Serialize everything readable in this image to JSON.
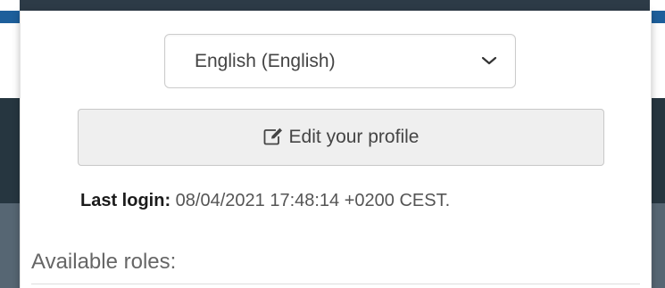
{
  "user_panel": {
    "language_select": {
      "selected": "English (English)"
    },
    "edit_profile_label": "Edit your profile",
    "last_login": {
      "label": "Last login:",
      "value": "08/04/2021 17:48:14 +0200 CEST."
    },
    "roles_heading": "Available roles:"
  },
  "icons": {
    "language_chevron": "chevron-down-icon",
    "edit": "edit-icon"
  },
  "colors": {
    "header_blue": "#1d5f9b",
    "sidebar_dark": "#263640",
    "panel_bg": "#ffffff",
    "button_bg": "#efefef"
  }
}
